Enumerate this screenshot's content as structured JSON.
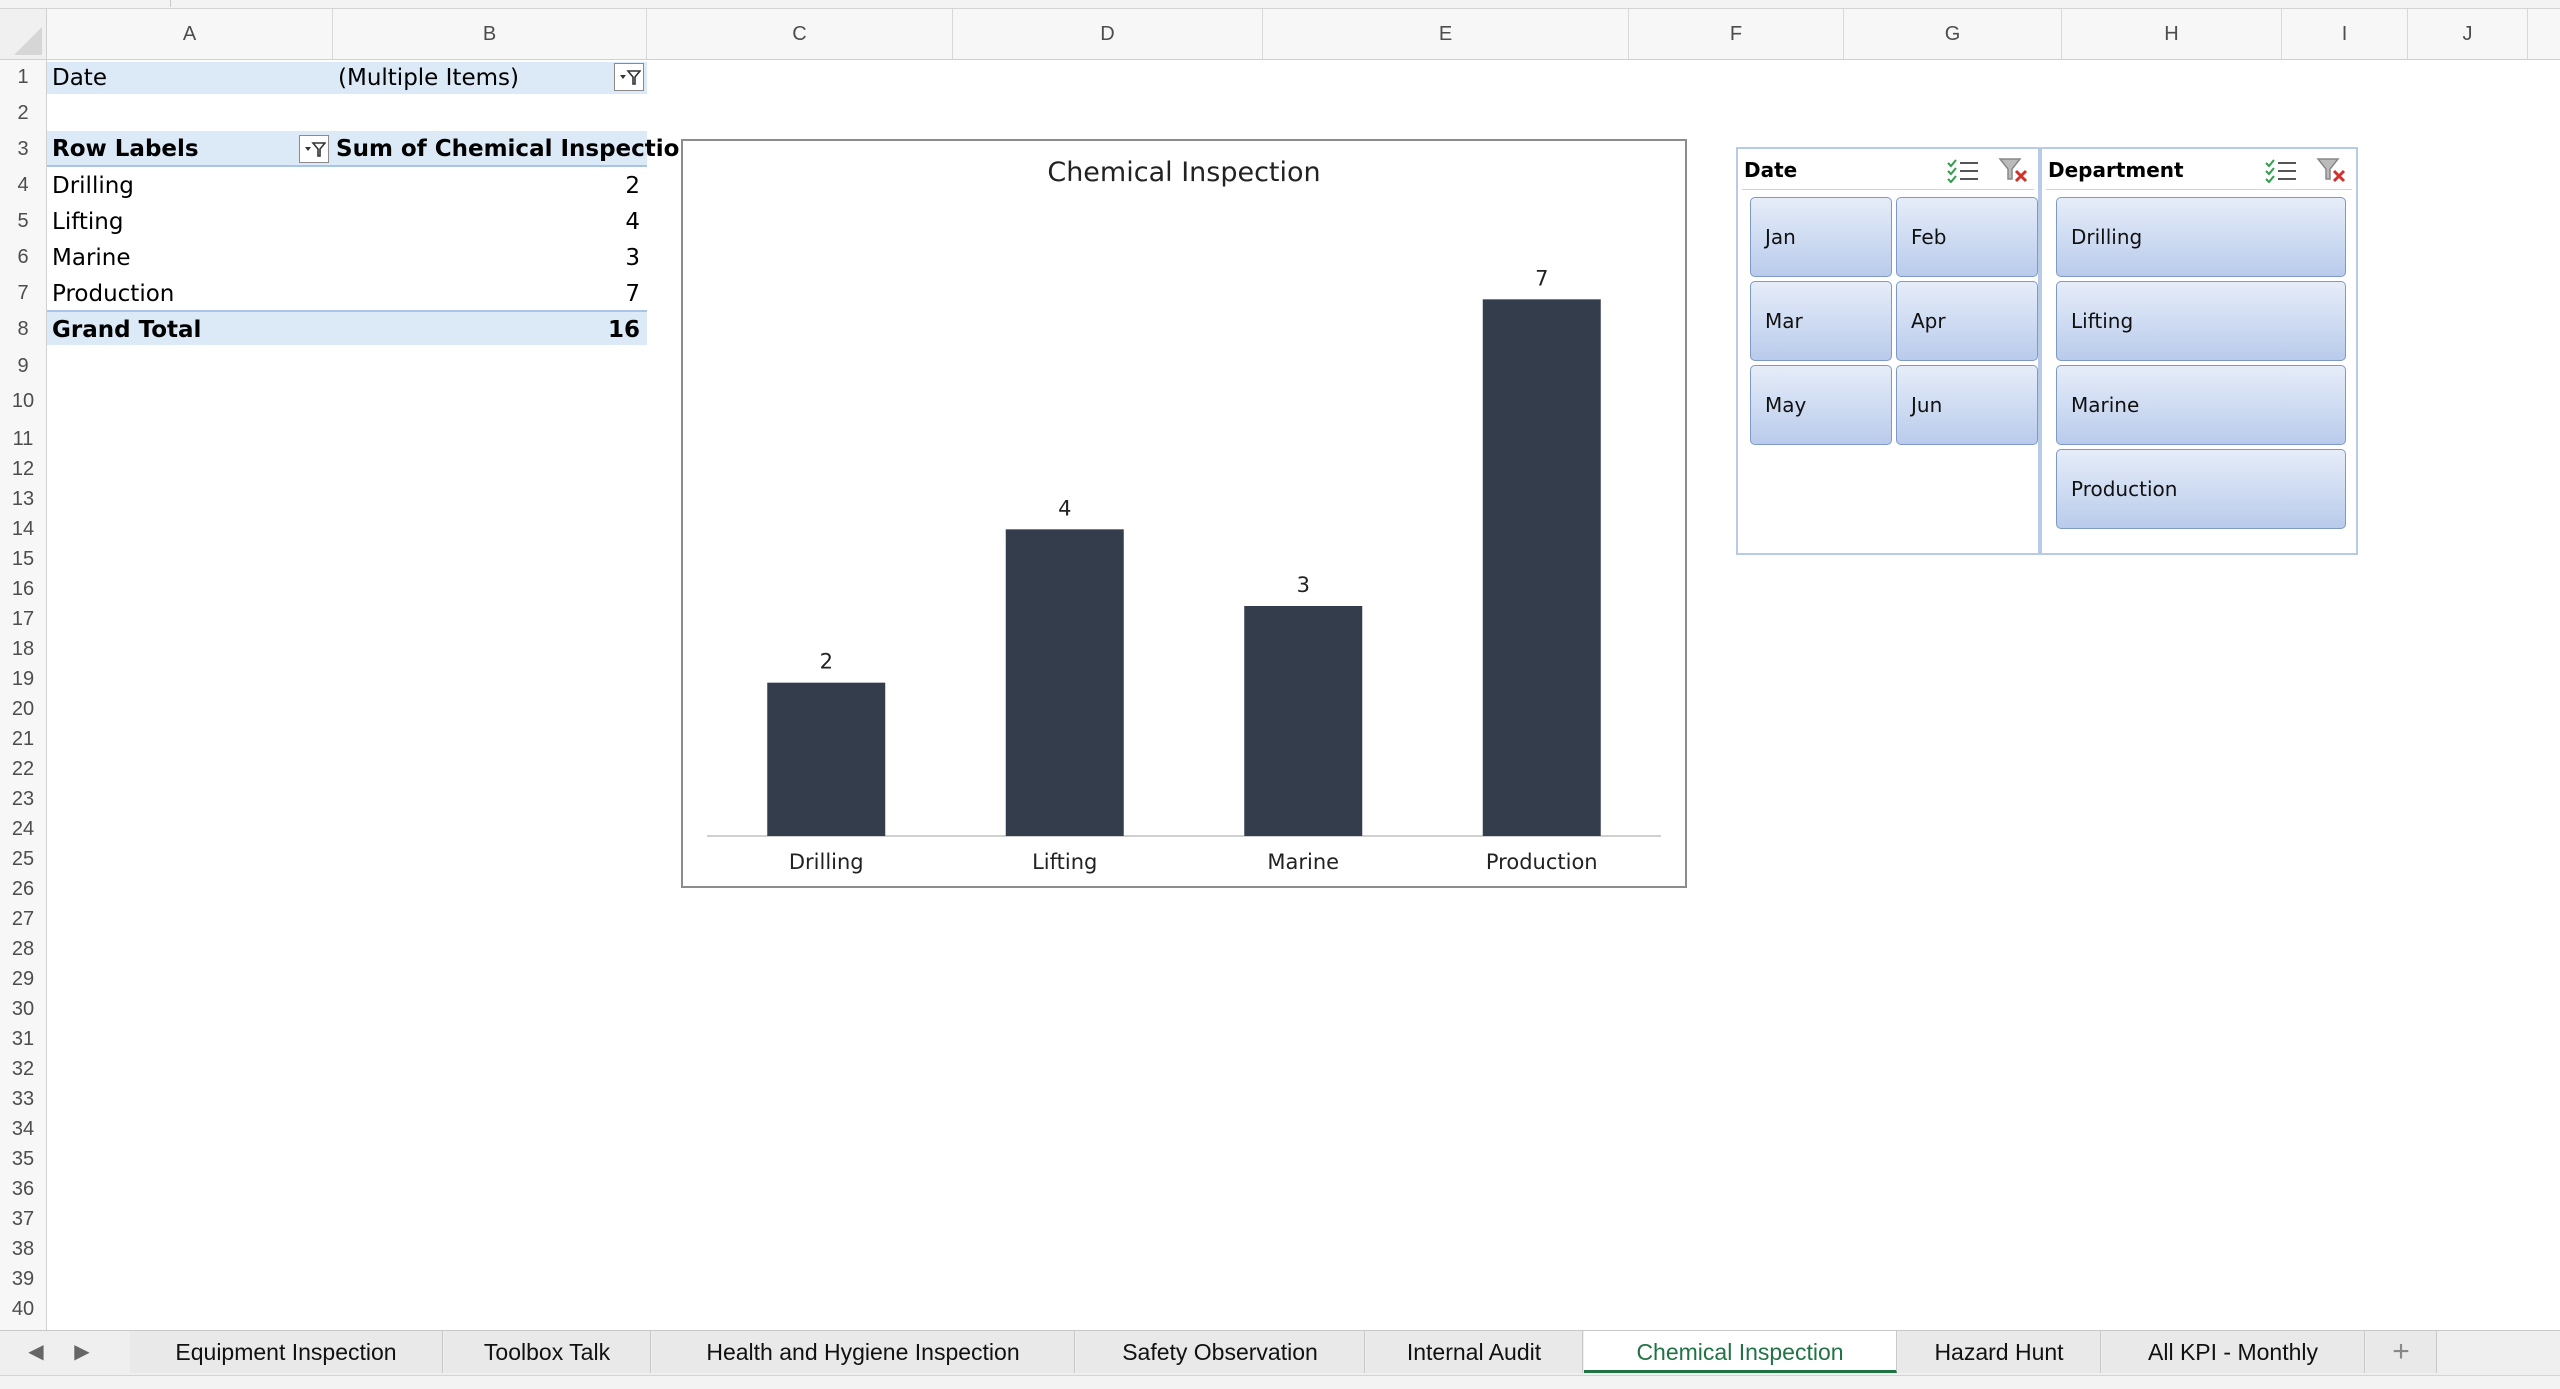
{
  "columns": [
    "A",
    "B",
    "C",
    "D",
    "E",
    "F",
    "G",
    "H",
    "I",
    "J"
  ],
  "rows": [
    "1",
    "2",
    "3",
    "4",
    "5",
    "6",
    "7",
    "8",
    "9",
    "10",
    "11",
    "12",
    "13",
    "14",
    "15",
    "16",
    "17",
    "18",
    "19",
    "20",
    "21",
    "22",
    "23",
    "24",
    "25",
    "26",
    "27",
    "28",
    "29",
    "30",
    "31",
    "32",
    "33",
    "34",
    "35",
    "36",
    "37",
    "38",
    "39",
    "40"
  ],
  "pivot": {
    "filter_label": "Date",
    "filter_value": "(Multiple Items)",
    "row_labels_header": "Row Labels",
    "sum_header": "Sum of Chemical Inspection",
    "rows": [
      {
        "label": "Drilling",
        "value": "2"
      },
      {
        "label": "Lifting",
        "value": "4"
      },
      {
        "label": "Marine",
        "value": "3"
      },
      {
        "label": "Production",
        "value": "7"
      }
    ],
    "grand_total_label": "Grand Total",
    "grand_total_value": "16"
  },
  "chart_data": {
    "type": "bar",
    "title": "Chemical Inspection",
    "categories": [
      "Drilling",
      "Lifting",
      "Marine",
      "Production"
    ],
    "values": [
      2,
      4,
      3,
      7
    ],
    "data_labels": [
      "2",
      "4",
      "3",
      "7"
    ],
    "ylim": [
      0,
      7.5
    ],
    "grid": false,
    "bar_color": "#343d4b"
  },
  "slicers": {
    "date": {
      "title": "Date",
      "items": [
        "Jan",
        "Feb",
        "Mar",
        "Apr",
        "May",
        "Jun"
      ]
    },
    "department": {
      "title": "Department",
      "items": [
        "Drilling",
        "Lifting",
        "Marine",
        "Production"
      ]
    }
  },
  "tabs": {
    "items": [
      "Equipment Inspection",
      "Toolbox Talk",
      "Health and Hygiene Inspection",
      "Safety Observation",
      "Internal Audit",
      "Chemical Inspection",
      "Hazard Hunt",
      "All KPI - Monthly"
    ],
    "active": "Chemical Inspection",
    "add_label": "+",
    "prev_icon": "left-arrow-icon",
    "next_icon": "right-arrow-icon"
  },
  "colors": {
    "accent_green": "#217346",
    "pivot_band": "#dce9f7",
    "slicer_fill": "#c9d7ef"
  }
}
